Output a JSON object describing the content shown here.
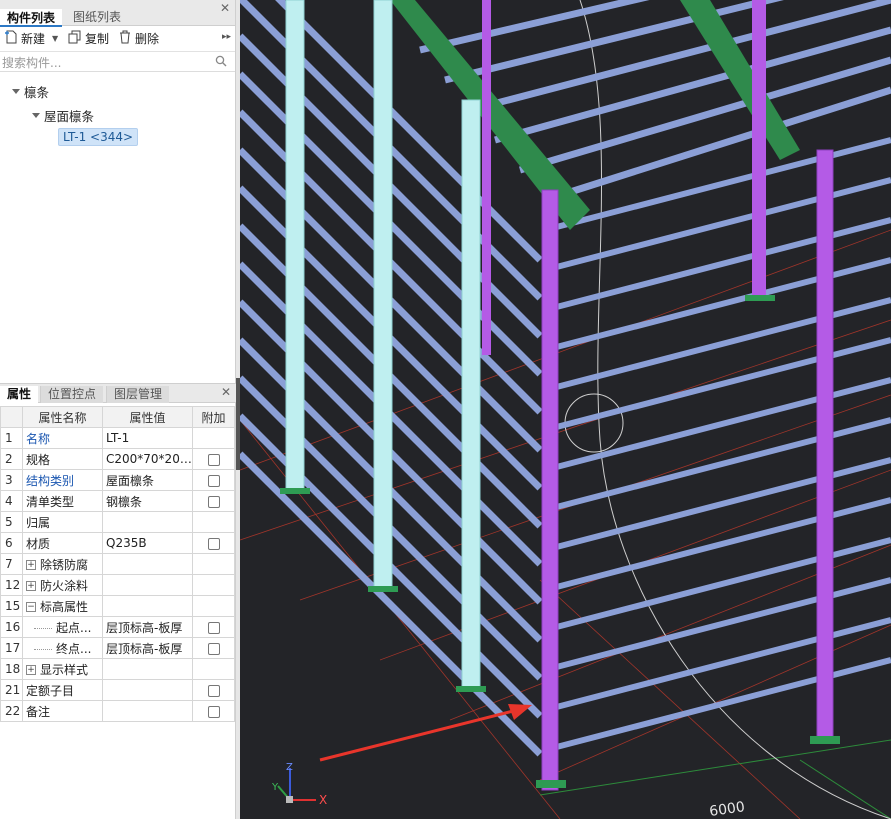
{
  "component_panel": {
    "tabs": [
      "构件列表",
      "图纸列表"
    ],
    "toolbar": {
      "new_label": "新建",
      "copy_label": "复制",
      "delete_label": "删除"
    },
    "search_placeholder": "搜索构件...",
    "tree": {
      "root": "檩条",
      "child": "屋面檩条",
      "item": "LT-1 <344>"
    }
  },
  "property_panel": {
    "tabs": [
      "属性",
      "位置控点",
      "图层管理"
    ],
    "headers": [
      "属性名称",
      "属性值",
      "附加"
    ],
    "rows": [
      {
        "num": "1",
        "name": "名称",
        "value": "LT-1",
        "blue": true,
        "checkbox": false
      },
      {
        "num": "2",
        "name": "规格",
        "value": "C200*70*20*...",
        "blue": false,
        "checkbox": true
      },
      {
        "num": "3",
        "name": "结构类别",
        "value": "屋面檩条",
        "blue": true,
        "checkbox": true
      },
      {
        "num": "4",
        "name": "清单类型",
        "value": "钢檩条",
        "blue": false,
        "checkbox": true
      },
      {
        "num": "5",
        "name": "归属",
        "value": "",
        "blue": false,
        "checkbox": false
      },
      {
        "num": "6",
        "name": "材质",
        "value": "Q235B",
        "blue": false,
        "checkbox": true
      },
      {
        "num": "7",
        "name": "除锈防腐",
        "value": "",
        "blue": false,
        "checkbox": false,
        "expander": "+"
      },
      {
        "num": "12",
        "name": "防火涂料",
        "value": "",
        "blue": false,
        "checkbox": false,
        "expander": "+"
      },
      {
        "num": "15",
        "name": "标高属性",
        "value": "",
        "blue": false,
        "checkbox": false,
        "expander": "−"
      },
      {
        "num": "16",
        "name": "起点...",
        "value": "层顶标高-板厚",
        "blue": false,
        "checkbox": true,
        "child": true
      },
      {
        "num": "17",
        "name": "终点...",
        "value": "层顶标高-板厚",
        "blue": false,
        "checkbox": true,
        "child": true
      },
      {
        "num": "18",
        "name": "显示样式",
        "value": "",
        "blue": false,
        "checkbox": false,
        "expander": "+"
      },
      {
        "num": "21",
        "name": "定额子目",
        "value": "",
        "blue": false,
        "checkbox": true
      },
      {
        "num": "22",
        "name": "备注",
        "value": "",
        "blue": false,
        "checkbox": true
      }
    ]
  },
  "viewport": {
    "dimension_label": "6000",
    "axis_x": "X",
    "axis_y": "Y",
    "axis_z": "Z"
  },
  "colors": {
    "viewport_bg": "#232428",
    "purlin": "#8b9fd6",
    "column_purple": "#b45be6",
    "column_cyan": "#bfeff0",
    "ridge_green": "#2f8a4c",
    "arrow_red": "#e8352b",
    "selection": "#cfe3f8"
  }
}
